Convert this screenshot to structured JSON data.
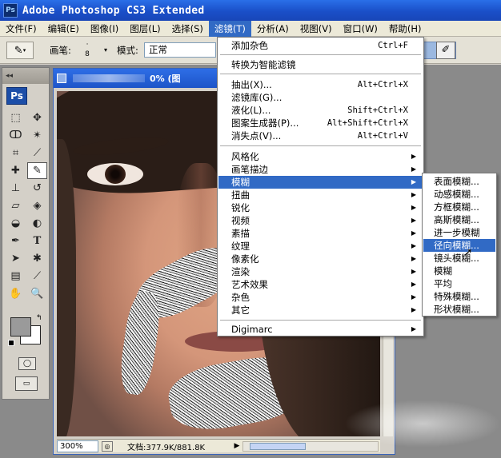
{
  "app": {
    "ps_logo": "Ps",
    "title": "Adobe Photoshop CS3 Extended"
  },
  "menubar": [
    "文件(F)",
    "编辑(E)",
    "图像(I)",
    "图层(L)",
    "选择(S)",
    "滤镜(T)",
    "分析(A)",
    "视图(V)",
    "窗口(W)",
    "帮助(H)"
  ],
  "options": {
    "brush_label": "画笔:",
    "brush_size": "8",
    "mode_label": "模式:",
    "mode_value": "正常"
  },
  "toolbox": {
    "badge": "Ps"
  },
  "document": {
    "title_suffix": "0% (图",
    "zoom": "300%",
    "doc_info": "文档:377.9K/881.8K"
  },
  "filter_menu": {
    "items": [
      {
        "label": "添加杂色",
        "shortcut": "Ctrl+F"
      },
      {
        "label": "转换为智能滤镜",
        "shortcut": ""
      },
      {
        "label": "抽出(X)...",
        "shortcut": "Alt+Ctrl+X"
      },
      {
        "label": "滤镜库(G)...",
        "shortcut": ""
      },
      {
        "label": "液化(L)...",
        "shortcut": "Shift+Ctrl+X"
      },
      {
        "label": "图案生成器(P)...",
        "shortcut": "Alt+Shift+Ctrl+X"
      },
      {
        "label": "消失点(V)...",
        "shortcut": "Alt+Ctrl+V"
      },
      {
        "label": "风格化"
      },
      {
        "label": "画笔描边"
      },
      {
        "label": "模糊"
      },
      {
        "label": "扭曲"
      },
      {
        "label": "锐化"
      },
      {
        "label": "视频"
      },
      {
        "label": "素描"
      },
      {
        "label": "纹理"
      },
      {
        "label": "像素化"
      },
      {
        "label": "渲染"
      },
      {
        "label": "艺术效果"
      },
      {
        "label": "杂色"
      },
      {
        "label": "其它"
      },
      {
        "label": "Digimarc"
      }
    ]
  },
  "blur_menu": {
    "items": [
      "表面模糊...",
      "动感模糊...",
      "方框模糊...",
      "高斯模糊...",
      "进一步模糊",
      "径向模糊...",
      "镜头模糊...",
      "模糊",
      "平均",
      "特殊模糊...",
      "形状模糊..."
    ]
  }
}
